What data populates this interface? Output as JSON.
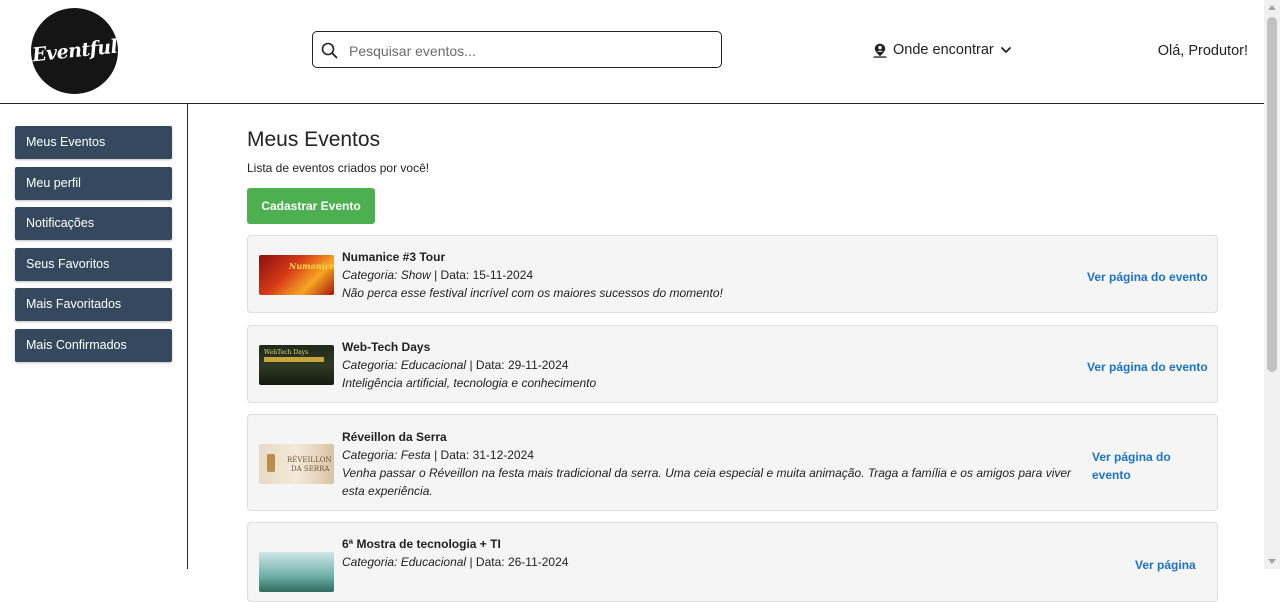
{
  "header": {
    "logo_text": "Eventful",
    "search_placeholder": "Pesquisar eventos...",
    "location_label": "Onde encontrar",
    "greeting": "Olá, Produtor!"
  },
  "sidebar": {
    "items": [
      {
        "label": "Meus Eventos"
      },
      {
        "label": "Meu perfil"
      },
      {
        "label": "Notificações"
      },
      {
        "label": "Seus Favoritos"
      },
      {
        "label": "Mais Favoritados"
      },
      {
        "label": "Mais Confirmados"
      }
    ]
  },
  "main": {
    "title": "Meus Eventos",
    "subtitle": "Lista de eventos criados por você!",
    "add_button": "Cadastrar Evento",
    "category_label": "Categoria:",
    "date_label": "Data:",
    "events": [
      {
        "title": "Numanice #3 Tour",
        "category": "Show",
        "date": "15-11-2024",
        "description": "Não perca esse festival incrível com os maiores sucessos do momento!",
        "link": "Ver página do evento"
      },
      {
        "title": "Web-Tech Days",
        "category": "Educacional",
        "date": "29-11-2024",
        "description": "Inteligência artificial, tecnologia e conhecimento",
        "link": "Ver página do evento"
      },
      {
        "title": "Réveillon da Serra",
        "category": "Festa",
        "date": "31-12-2024",
        "description": "Venha passar o Réveillon na festa mais tradicional da serra. Uma ceia especial e muita animação. Traga a família e os amigos para viver esta experiência.",
        "link": "Ver página do evento"
      },
      {
        "title": "6ª Mostra de tecnologia + TI",
        "category": "Educacional",
        "date": "26-11-2024",
        "description": "",
        "link": "Ver página"
      }
    ]
  },
  "colors": {
    "sidebar_button": "#34495e",
    "add_button": "#4caf50",
    "link": "#1a73c6",
    "card_bg": "#f5f5f5"
  },
  "icons": {
    "search": "search-icon",
    "location": "map-pin-user-icon",
    "dropdown": "chevron-down-icon"
  }
}
